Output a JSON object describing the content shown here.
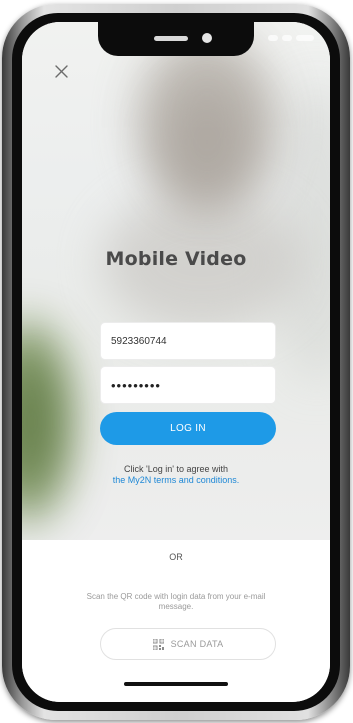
{
  "app": {
    "title": "Mobile Video"
  },
  "login": {
    "username_value": "5923360744",
    "password_value": "•••••••••",
    "login_label": "LOG IN",
    "agree_text": "Click 'Log in' to agree with",
    "terms_link": "the My2N terms and conditions."
  },
  "alternate": {
    "or_label": "OR",
    "scan_instructions": "Scan the QR code with login data from your e-mail message.",
    "scan_button_label": "SCAN DATA"
  },
  "icons": {
    "close": "close-icon",
    "qr": "qr-code-icon"
  },
  "colors": {
    "accent": "#1e9ae7",
    "link": "#1e88d6",
    "title": "#4a4a4a"
  }
}
